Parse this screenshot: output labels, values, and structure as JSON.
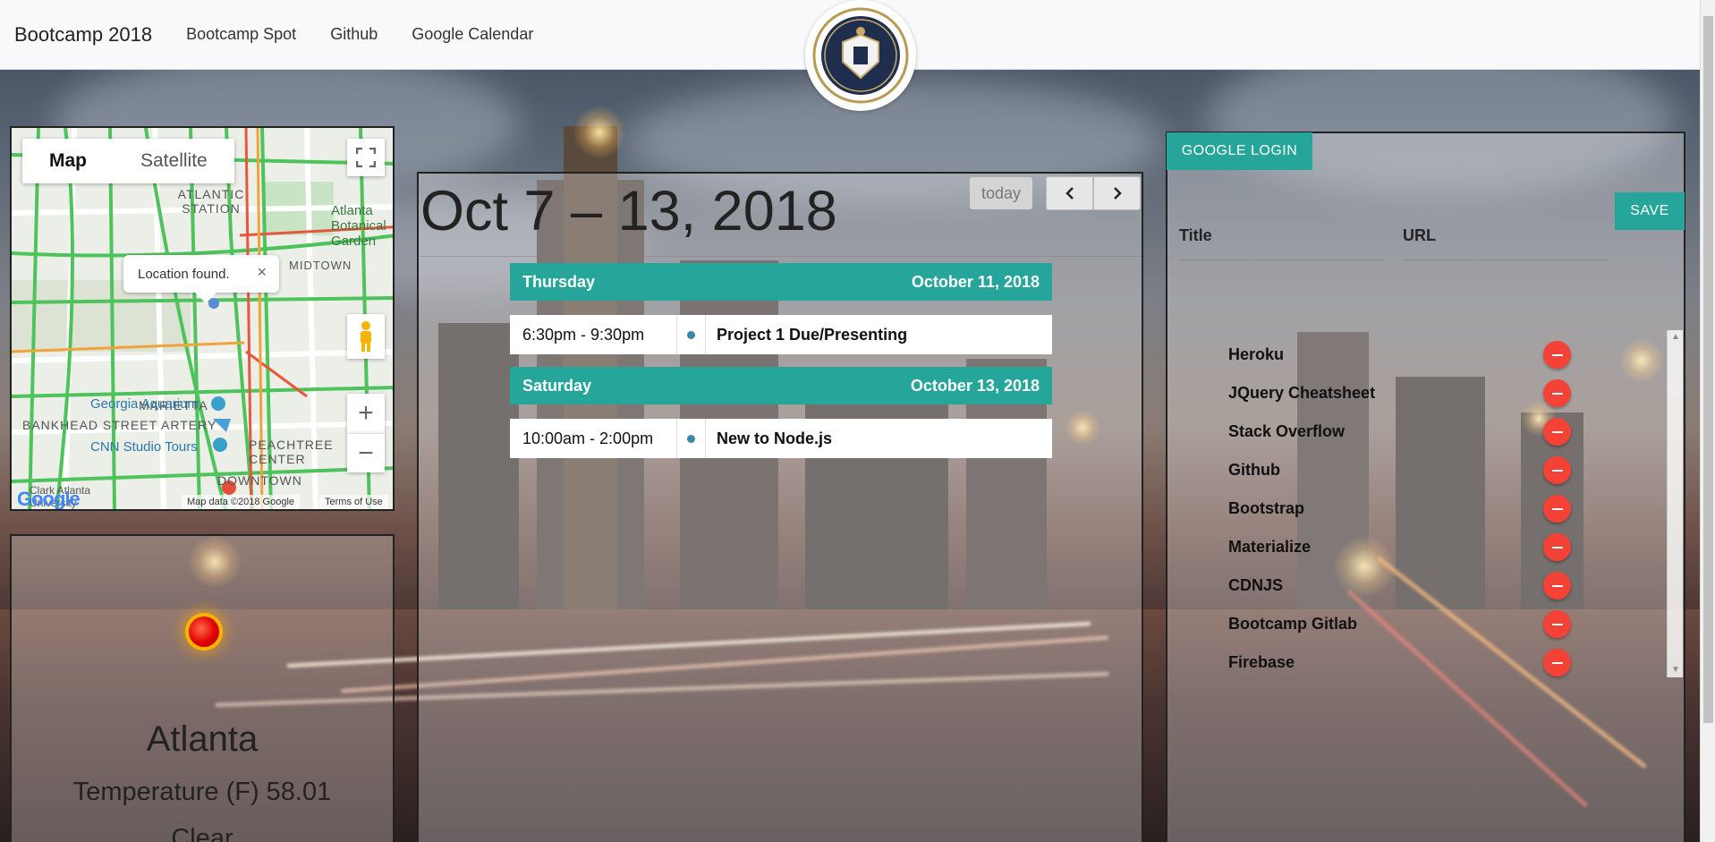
{
  "navbar": {
    "brand": "Bootcamp 2018",
    "links": [
      "Bootcamp Spot",
      "Github",
      "Google Calendar"
    ],
    "logo_icon": "georgia-tech-seal-icon"
  },
  "map": {
    "tabs": [
      "Map",
      "Satellite"
    ],
    "active_tab": "Map",
    "tooltip": "Location found.",
    "tooltip_close": "×",
    "zoom_in": "+",
    "zoom_out": "−",
    "labels": [
      "ATLANTIC STATION",
      "Atlanta Botanical Garden",
      "MIDTOWN",
      "MARIETTA",
      "BANKHEAD STREET ARTERY",
      "Georgia Aquarium",
      "CNN Studio Tours",
      "PEACHTREE CENTER",
      "DOWNTOWN",
      "Clark Atlanta University"
    ],
    "attribution_logo": "Google",
    "attribution_data": "Map data ©2018 Google",
    "attribution_terms": "Terms of Use"
  },
  "weather": {
    "icon": "clear-sun-icon",
    "city": "Atlanta",
    "temperature": "Temperature (F) 58.01",
    "condition": "Clear"
  },
  "calendar": {
    "title": "Oct 7 – 13, 2018",
    "today_label": "today",
    "prev_icon": "chevron-left-icon",
    "next_icon": "chevron-right-icon",
    "days": [
      {
        "weekday": "Thursday",
        "date": "October 11, 2018",
        "events": [
          {
            "time": "6:30pm - 9:30pm",
            "title": "Project 1 Due/Presenting"
          }
        ]
      },
      {
        "weekday": "Saturday",
        "date": "October 13, 2018",
        "events": [
          {
            "time": "10:00am - 2:00pm",
            "title": "New to Node.js"
          }
        ]
      }
    ],
    "event_dot_color": "#3a87ad"
  },
  "links_panel": {
    "login_label": "GOOGLE LOGIN",
    "save_label": "SAVE",
    "title_label": "Title",
    "url_label": "URL",
    "items": [
      "Heroku",
      "JQuery Cheatsheet",
      "Stack Overflow",
      "Github",
      "Bootstrap",
      "Materialize",
      "CDNJS",
      "Bootcamp Gitlab",
      "Firebase"
    ],
    "delete_icon": "remove-circle-icon"
  },
  "colors": {
    "accent": "#26a69a",
    "delete": "#f44336"
  }
}
